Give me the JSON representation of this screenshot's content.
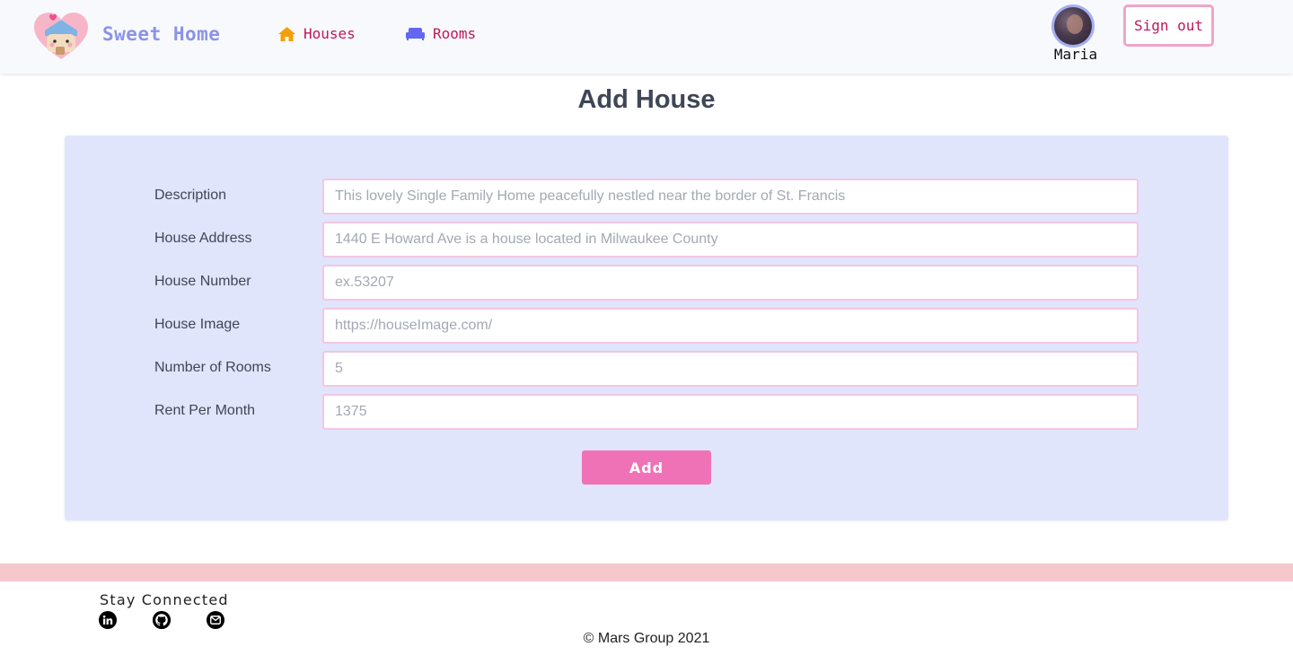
{
  "app": {
    "brand": "Sweet Home"
  },
  "nav": {
    "items": [
      {
        "label": "Houses",
        "icon": "home-icon",
        "color": "#f59e0b"
      },
      {
        "label": "Rooms",
        "icon": "sofa-icon",
        "color": "#6366f1"
      }
    ]
  },
  "user": {
    "name": "Maria",
    "avatar": "user-avatar"
  },
  "signout_label": "Sign out",
  "page": {
    "title": "Add House"
  },
  "form": {
    "fields": [
      {
        "label": "Description",
        "placeholder": "This lovely Single Family Home peacefully nestled near the border of St. Francis",
        "value": ""
      },
      {
        "label": "House Address",
        "placeholder": "1440 E Howard Ave is a house located in Milwaukee County",
        "value": ""
      },
      {
        "label": "House Number",
        "placeholder": "ex.53207",
        "value": ""
      },
      {
        "label": "House Image",
        "placeholder": "https://houseImage.com/",
        "value": ""
      },
      {
        "label": "Number of Rooms",
        "placeholder": "5",
        "value": ""
      },
      {
        "label": "Rent Per Month",
        "placeholder": "1375",
        "value": ""
      }
    ],
    "submit_label": "Add"
  },
  "footer": {
    "stay_connected": "Stay Connected",
    "social": [
      "linkedin-icon",
      "github-icon",
      "mail-icon"
    ],
    "copyright": "© Mars Group 2021"
  },
  "colors": {
    "accent_pink": "#f072b6",
    "nav_text": "#be185d",
    "brand": "#8b93e6",
    "form_bg": "#e0e5fb",
    "footer_band": "#f7c8cb"
  }
}
